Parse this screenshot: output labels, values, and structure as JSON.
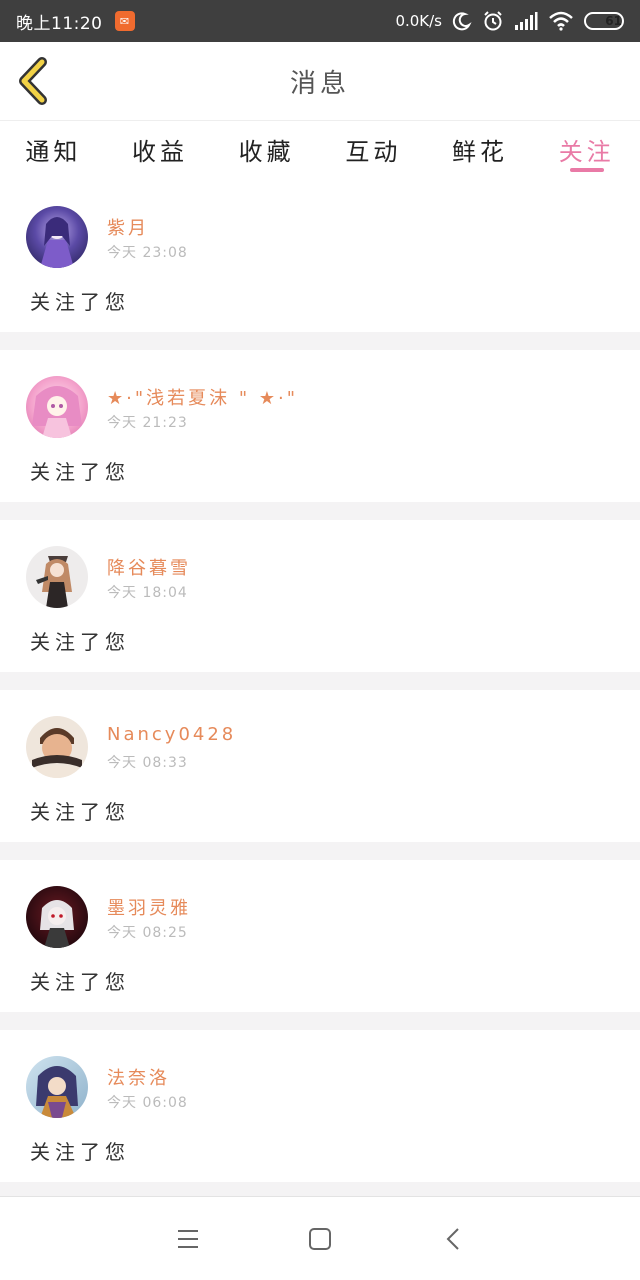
{
  "status_bar": {
    "time": "晚上11:20",
    "app_badge": "✉",
    "net_speed": "0.0K/s",
    "battery": "61"
  },
  "header": {
    "title": "消息"
  },
  "tabs": [
    {
      "label": "通知"
    },
    {
      "label": "收益"
    },
    {
      "label": "收藏"
    },
    {
      "label": "互动"
    },
    {
      "label": "鲜花"
    },
    {
      "label": "关注",
      "active": true
    }
  ],
  "messages": [
    {
      "username": "紫月",
      "time": "今天 23:08",
      "action": "关注了您"
    },
    {
      "username": "★·\"浅若夏沫 \" ★·\"",
      "time": "今天 21:23",
      "action": "关注了您"
    },
    {
      "username": "降谷暮雪",
      "time": "今天 18:04",
      "action": "关注了您"
    },
    {
      "username": "Nancy0428",
      "time": "今天 08:33",
      "action": "关注了您"
    },
    {
      "username": "墨羽灵雅",
      "time": "今天 08:25",
      "action": "关注了您"
    },
    {
      "username": "法奈洛",
      "time": "今天 06:08",
      "action": "关注了您"
    }
  ],
  "colors": {
    "accent": "#e97aa6",
    "username": "#e68a5a",
    "back_arrow": "#f2d246"
  }
}
